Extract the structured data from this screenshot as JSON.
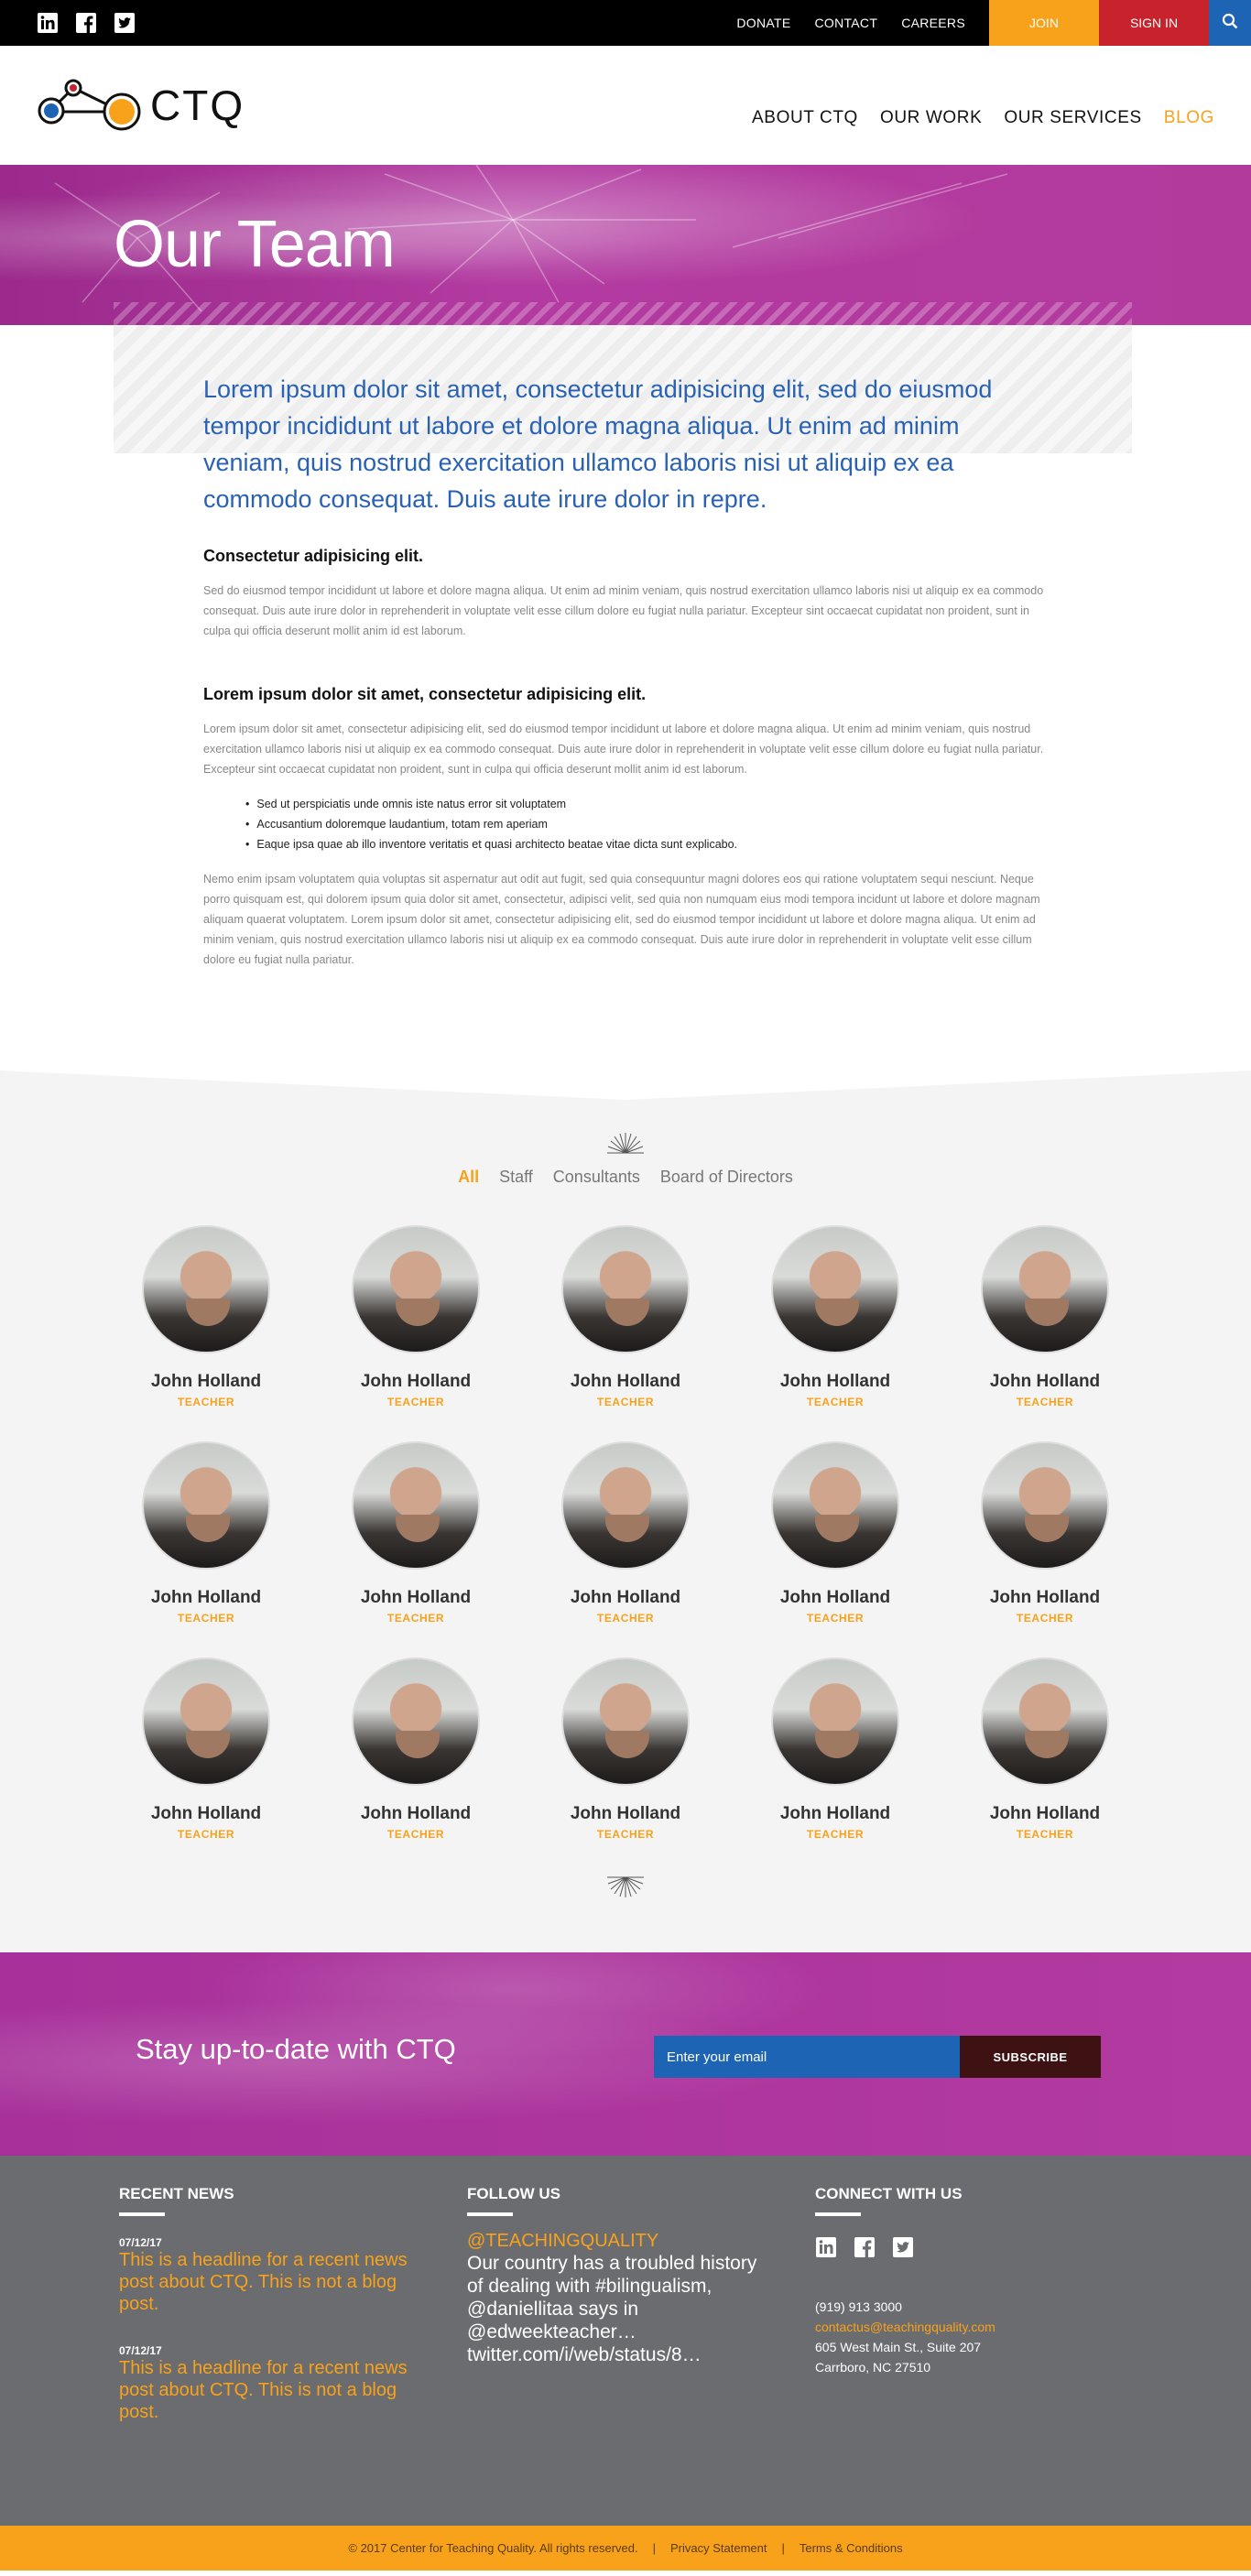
{
  "topbar": {
    "social": [
      "linkedin-icon",
      "facebook-icon",
      "twitter-icon"
    ],
    "links": [
      "DONATE",
      "CONTACT",
      "CAREERS"
    ],
    "join": "JOIN",
    "signin": "SIGN IN"
  },
  "header": {
    "logo_text": "CTQ",
    "nav": [
      "ABOUT CTQ",
      "OUR WORK",
      "OUR SERVICES",
      "BLOG"
    ],
    "active_nav": "BLOG"
  },
  "hero": {
    "title": "Our Team"
  },
  "intro": {
    "lead": "Lorem ipsum dolor sit amet, consectetur adipisicing elit, sed do eiusmod tempor incididunt ut labore et dolore magna aliqua. Ut enim ad minim veniam, quis nostrud exercitation ullamco laboris nisi ut aliquip ex ea commodo consequat. Duis aute irure dolor in repre.",
    "heading1": "Consectetur adipisicing elit.",
    "para1": "Sed do eiusmod tempor incididunt ut labore et dolore magna aliqua. Ut enim ad minim veniam, quis nostrud exercitation ullamco laboris nisi ut aliquip ex ea commodo consequat. Duis aute irure dolor in reprehenderit in voluptate velit esse cillum dolore eu fugiat nulla pariatur. Excepteur sint occaecat cupidatat non proident, sunt in culpa qui officia deserunt mollit anim id est laborum.",
    "heading2": "Lorem ipsum dolor sit amet, consectetur adipisicing elit.",
    "para2": "Lorem ipsum dolor sit amet, consectetur adipisicing elit, sed do eiusmod tempor incididunt ut labore et dolore magna aliqua. Ut enim ad minim veniam, quis nostrud exercitation ullamco laboris nisi ut aliquip ex ea commodo consequat. Duis aute irure dolor in reprehenderit in voluptate velit esse cillum dolore eu fugiat nulla pariatur. Excepteur sint occaecat cupidatat non proident, sunt in culpa qui officia deserunt mollit anim id est laborum.",
    "bullets": [
      "Sed ut perspiciatis unde omnis iste natus error sit voluptatem",
      "Accusantium doloremque laudantium, totam rem aperiam",
      "Eaque ipsa quae ab illo inventore veritatis et quasi architecto beatae vitae dicta sunt explicabo."
    ],
    "para3": "Nemo enim ipsam voluptatem quia voluptas sit aspernatur aut odit aut fugit, sed quia consequuntur magni dolores eos qui ratione voluptatem sequi nesciunt. Neque porro quisquam est, qui dolorem ipsum quia dolor sit amet, consectetur, adipisci velit, sed quia non numquam eius modi tempora incidunt ut labore et dolore magnam aliquam quaerat voluptatem. Lorem ipsum dolor sit amet, consectetur adipisicing elit, sed do eiusmod tempor incididunt ut labore et dolore magna aliqua. Ut enim ad minim veniam, quis nostrud exercitation ullamco laboris nisi ut aliquip ex ea commodo consequat. Duis aute irure dolor in reprehenderit in voluptate velit esse cillum dolore eu fugiat nulla pariatur."
  },
  "team": {
    "filters": [
      "All",
      "Staff",
      "Consultants",
      "Board of Directors"
    ],
    "active_filter": "All",
    "members": [
      {
        "name": "John Holland",
        "role": "TEACHER"
      },
      {
        "name": "John Holland",
        "role": "TEACHER"
      },
      {
        "name": "John Holland",
        "role": "TEACHER"
      },
      {
        "name": "John Holland",
        "role": "TEACHER"
      },
      {
        "name": "John Holland",
        "role": "TEACHER"
      },
      {
        "name": "John Holland",
        "role": "TEACHER"
      },
      {
        "name": "John Holland",
        "role": "TEACHER"
      },
      {
        "name": "John Holland",
        "role": "TEACHER"
      },
      {
        "name": "John Holland",
        "role": "TEACHER"
      },
      {
        "name": "John Holland",
        "role": "TEACHER"
      },
      {
        "name": "John Holland",
        "role": "TEACHER"
      },
      {
        "name": "John Holland",
        "role": "TEACHER"
      },
      {
        "name": "John Holland",
        "role": "TEACHER"
      },
      {
        "name": "John Holland",
        "role": "TEACHER"
      },
      {
        "name": "John Holland",
        "role": "TEACHER"
      }
    ]
  },
  "newsletter": {
    "text": "Stay up-to-date with CTQ",
    "placeholder": "Enter your email",
    "button": "SUBSCRIBE"
  },
  "footer": {
    "recent_title": "RECENT NEWS",
    "news": [
      {
        "date": "07/12/17",
        "headline": "This is a headline for a recent news post about CTQ. This is not a blog post."
      },
      {
        "date": "07/12/17",
        "headline": "This is a headline for a recent news post about CTQ. This is not a blog post."
      }
    ],
    "follow_title": "FOLLOW US",
    "handle": "@TEACHINGQUALITY",
    "tweet": "Our country has a troubled history of dealing with #bilingualism, @daniellitaa says in @edweekteacher… twitter.com/i/web/status/8…",
    "connect_title": "CONNECT WITH US",
    "phone": "(919) 913 3000",
    "email": "contactus@teachingquality.com",
    "address1": "605 West Main St., Suite 207",
    "address2": "Carrboro, NC 27510"
  },
  "copyright": {
    "text": "© 2017 Center for Teaching Quality. All rights reserved.",
    "privacy": "Privacy Statement",
    "terms": "Terms & Conditions"
  },
  "colors": {
    "orange": "#f7a21a",
    "red": "#c8232c",
    "blue": "#1e64b4",
    "purple": "#b23aa0",
    "footer_gray": "#6b6c70"
  }
}
